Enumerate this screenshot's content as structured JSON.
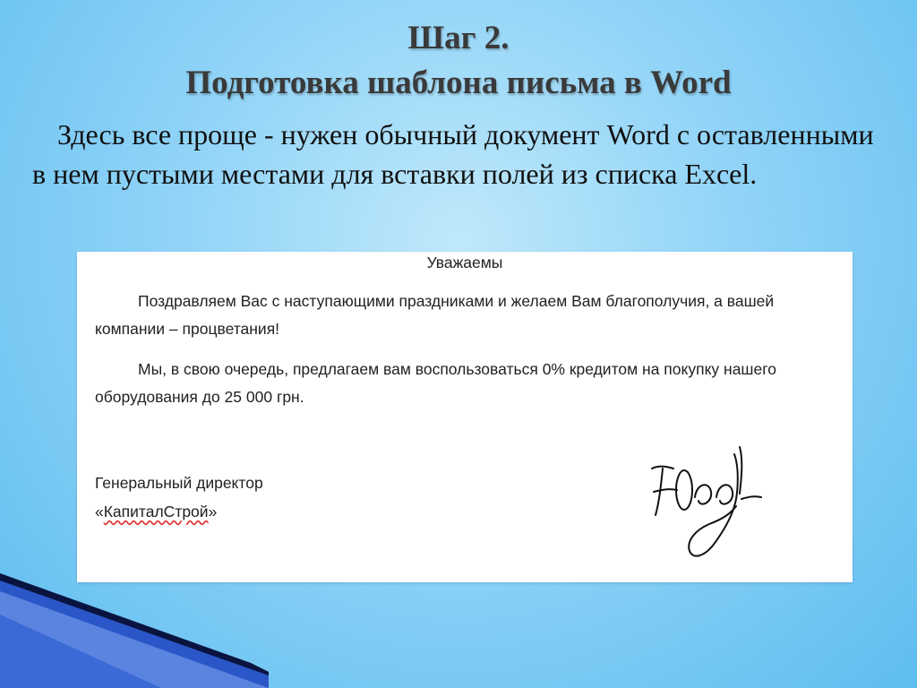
{
  "slide": {
    "title_line1": "Шаг 2.",
    "title_line2": "Подготовка шаблона письма в Word",
    "body_text": "Здесь все проще - нужен обычный документ Word с оставленными в нем пустыми местами для вставки полей из списка Excel."
  },
  "letter": {
    "greeting": "Уважаемы",
    "paragraph1": "Поздравляем Вас с наступающими праздниками и желаем Вам благополучия, а вашей компании – процветания!",
    "paragraph2": "Мы, в свою очередь, предлагаем вам воспользоваться 0% кредитом на покупку нашего оборудования до 25 000 грн.",
    "signer_title": "Генеральный директор",
    "company_open_quote": "«",
    "company_name": "КапиталСтрой",
    "company_close_quote": "»",
    "signature_text": "Юеег"
  },
  "colors": {
    "background": "#8fd3f7",
    "title_text": "#3a3a3a",
    "stripe_dark": "#0a1440",
    "stripe_blue": "#2a56c8"
  }
}
